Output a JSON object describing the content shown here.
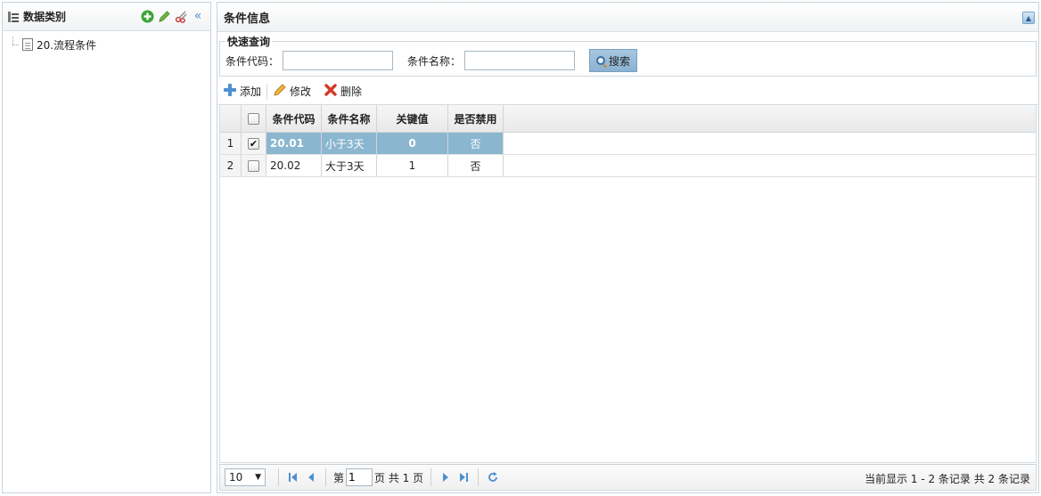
{
  "left": {
    "title": "数据类别",
    "tools": [
      "add-icon",
      "edit-icon",
      "cut-icon",
      "collapse-left-icon"
    ],
    "tree": [
      {
        "label": "20.流程条件"
      }
    ]
  },
  "right": {
    "title": "条件信息",
    "quick_search": {
      "legend": "快速查询",
      "code_label": "条件代码：",
      "code_value": "",
      "name_label": "条件名称：",
      "name_value": "",
      "search_label": "搜索"
    },
    "toolbar": {
      "add_label": "添加",
      "edit_label": "修改",
      "delete_label": "删除"
    },
    "grid": {
      "columns": [
        "条件代码",
        "条件名称",
        "关键值",
        "是否禁用"
      ],
      "rows": [
        {
          "num": "1",
          "checked": true,
          "code": "20.01",
          "name": "小于3天",
          "key": "0",
          "disabled": "否"
        },
        {
          "num": "2",
          "checked": false,
          "code": "20.02",
          "name": "大于3天",
          "key": "1",
          "disabled": "否"
        }
      ]
    },
    "pager": {
      "page_size": "10",
      "page_prefix": "第",
      "current_page": "1",
      "page_suffix": "页 共 1 页",
      "info": "当前显示 1 - 2 条记录 共 2 条记录"
    }
  },
  "colors": {
    "selected_row": "#8bb6d0",
    "panel_border": "#c8d3dc",
    "pager_icon": "#4f8fd1",
    "add_green": "#3aa335",
    "delete_red": "#d23a2a"
  }
}
